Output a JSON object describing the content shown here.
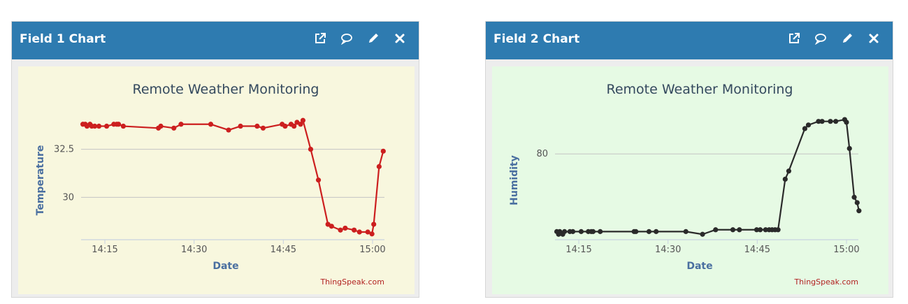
{
  "colors": {
    "header_bg": "#2e7bb0",
    "chart1_bg": "#f8f7de",
    "chart2_bg": "#e6fae4",
    "series1": "#cc1f1f",
    "series2": "#2a2a2a",
    "axis_title": "#4a6fa0",
    "credit": "#b22222"
  },
  "panels": [
    {
      "title": "Field 1 Chart",
      "icons": [
        "external-link-icon",
        "comment-icon",
        "pencil-icon",
        "close-icon"
      ]
    },
    {
      "title": "Field 2 Chart",
      "icons": [
        "external-link-icon",
        "comment-icon",
        "pencil-icon",
        "close-icon"
      ]
    }
  ],
  "chart_data": [
    {
      "type": "line",
      "title": "Remote Weather Monitoring",
      "xlabel": "Date",
      "ylabel": "Temperature",
      "credit": "ThingSpeak.com",
      "grid": true,
      "xtick_labels": [
        "14:15",
        "14:30",
        "14:45",
        "15:00"
      ],
      "ytick_labels": [
        "30",
        "32.5"
      ],
      "ytick_values": [
        30,
        32.5
      ],
      "xlim": [
        "14:11",
        "15:02"
      ],
      "ylim": [
        27.8,
        34.7
      ],
      "series": [
        {
          "x": [
            "14:11.3",
            "14:11.7",
            "14:12.0",
            "14:12.5",
            "14:12.8",
            "14:13.3",
            "14:14.0",
            "14:15.3",
            "14:16.5",
            "14:17.0",
            "14:17.3",
            "14:18.1",
            "14:24.0",
            "14:24.4",
            "14:26.6",
            "14:27.8",
            "14:32.8",
            "14:35.8",
            "14:37.8",
            "14:40.6",
            "14:41.6",
            "14:44.8",
            "14:45.3",
            "14:46.3",
            "14:46.8",
            "14:47.3",
            "14:47.9",
            "14:48.3",
            "14:49.6",
            "14:50.9",
            "14:52.5",
            "14:53.1",
            "14:54.6",
            "14:55.4",
            "14:56.9",
            "14:57.8",
            "14:59.2",
            "14:59.9",
            "15:00.2",
            "15:01.1",
            "15:01.8"
          ],
          "values": [
            33.8,
            33.8,
            33.7,
            33.8,
            33.7,
            33.7,
            33.7,
            33.7,
            33.8,
            33.8,
            33.8,
            33.7,
            33.6,
            33.7,
            33.6,
            33.8,
            33.8,
            33.5,
            33.7,
            33.7,
            33.6,
            33.8,
            33.7,
            33.8,
            33.7,
            33.9,
            33.8,
            34.0,
            32.5,
            30.9,
            28.6,
            28.5,
            28.3,
            28.4,
            28.3,
            28.2,
            28.2,
            28.1,
            28.6,
            31.6,
            32.4
          ]
        }
      ]
    },
    {
      "type": "line",
      "title": "Remote Weather Monitoring",
      "xlabel": "Date",
      "ylabel": "Humidity",
      "credit": "ThingSpeak.com",
      "grid": true,
      "xtick_labels": [
        "14:15",
        "14:30",
        "14:45",
        "15:00"
      ],
      "ytick_labels": [
        "80"
      ],
      "ytick_values": [
        80
      ],
      "xlim": [
        "14:11",
        "15:02"
      ],
      "ylim": [
        70.5,
        85.2
      ],
      "series": [
        {
          "x": [
            "14:11.3",
            "14:11.6",
            "14:11.8",
            "14:12.3",
            "14:12.6",
            "14:13.5",
            "14:14.0",
            "14:15.4",
            "14:16.6",
            "14:17.1",
            "14:17.4",
            "14:18.6",
            "14:24.3",
            "14:24.6",
            "14:26.8",
            "14:28.0",
            "14:33.0",
            "14:35.8",
            "14:38.0",
            "14:40.9",
            "14:42.0",
            "14:44.9",
            "14:45.5",
            "14:46.4",
            "14:47.0",
            "14:47.5",
            "14:48.0",
            "14:48.5",
            "14:49.7",
            "14:50.3",
            "14:53.0",
            "14:53.6",
            "14:55.3",
            "14:55.9",
            "14:57.3",
            "14:58.2",
            "14:59.7",
            "15:00.0",
            "15:00.5",
            "15:01.3",
            "15:01.8",
            "15:02.1"
          ],
          "values": [
            71.4,
            71.1,
            71.4,
            71.1,
            71.4,
            71.4,
            71.4,
            71.4,
            71.4,
            71.4,
            71.4,
            71.4,
            71.4,
            71.4,
            71.4,
            71.4,
            71.4,
            71.1,
            71.6,
            71.6,
            71.6,
            71.6,
            71.6,
            71.6,
            71.6,
            71.6,
            71.6,
            71.6,
            77.2,
            78.1,
            82.8,
            83.2,
            83.6,
            83.6,
            83.6,
            83.6,
            83.8,
            83.5,
            80.6,
            75.2,
            74.6,
            73.7
          ]
        }
      ]
    }
  ]
}
